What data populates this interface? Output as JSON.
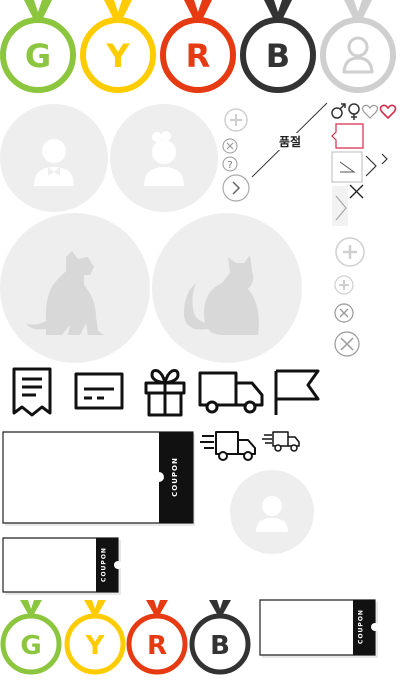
{
  "colors": {
    "green": "#8cc63f",
    "yellow": "#ffcc00",
    "red": "#e63a12",
    "black": "#333333",
    "gray": "#cfcfcf",
    "placeholder_bg": "#eeeeee",
    "placeholder_fg": "#ffffff",
    "heart_red": "#d62b4b"
  },
  "medals_large": [
    {
      "letter": "G",
      "color": "#8cc63f",
      "icon": "medal-g-icon"
    },
    {
      "letter": "Y",
      "color": "#ffcc00",
      "icon": "medal-y-icon"
    },
    {
      "letter": "R",
      "color": "#e63a12",
      "icon": "medal-r-icon"
    },
    {
      "letter": "B",
      "color": "#333333",
      "icon": "medal-b-icon"
    },
    {
      "letter": "",
      "color": "#cfcfcf",
      "icon": "medal-user-icon"
    }
  ],
  "medals_small": [
    {
      "letter": "G",
      "color": "#8cc63f"
    },
    {
      "letter": "Y",
      "color": "#ffcc00"
    },
    {
      "letter": "R",
      "color": "#e63a12"
    },
    {
      "letter": "B",
      "color": "#333333"
    }
  ],
  "soldout_label": "품절",
  "coupon_label": "COUPON",
  "icons": [
    "male-symbol-icon",
    "female-symbol-icon",
    "heart-outline-icon",
    "heart-red-icon",
    "plus-circle-icon",
    "close-circle-icon",
    "help-circle-icon",
    "chevron-right-circle-icon",
    "receipt-icon",
    "card-icon",
    "gift-icon",
    "truck-icon",
    "flag-icon",
    "fast-delivery-icon"
  ]
}
